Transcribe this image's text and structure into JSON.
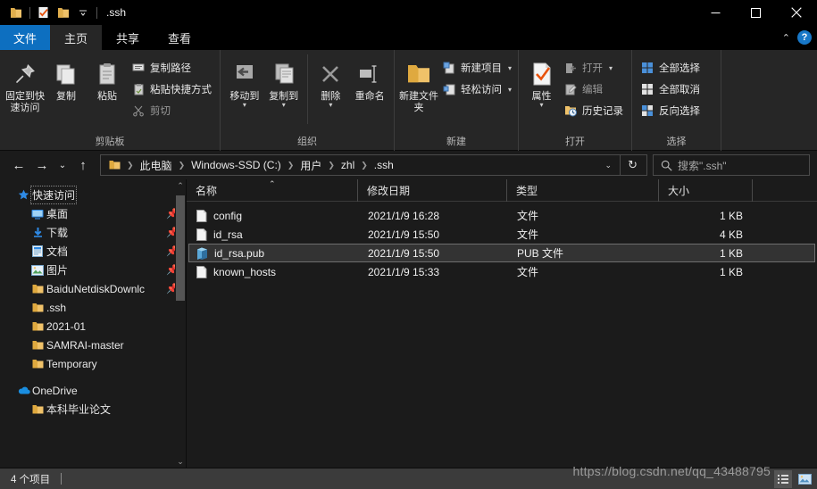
{
  "window": {
    "title": ".ssh",
    "quick_access": [
      {
        "name": "folder-icon",
        "label": "文件资源管理器"
      },
      {
        "name": "properties-icon",
        "label": "属性"
      },
      {
        "name": "new-folder-icon",
        "label": "新建文件夹"
      },
      {
        "name": "customize-chevron-icon",
        "label": "自定义快速访问工具栏"
      }
    ],
    "controls": {
      "minimize": "–",
      "maximize": "☐",
      "close": "✕"
    }
  },
  "tabs": [
    {
      "label": "文件",
      "kind": "file"
    },
    {
      "label": "主页",
      "kind": "active"
    },
    {
      "label": "共享",
      "kind": "normal"
    },
    {
      "label": "查看",
      "kind": "normal"
    }
  ],
  "tabbar_right": {
    "collapse": "⌃",
    "help": "?"
  },
  "ribbon": {
    "groups": [
      {
        "label": "剪贴板",
        "big": [
          {
            "label": "固定到快速访问",
            "icon": "pin-icon"
          },
          {
            "label": "复制",
            "icon": "copy-icon"
          },
          {
            "label": "粘贴",
            "icon": "paste-icon"
          }
        ],
        "small": [
          {
            "label": "复制路径",
            "icon": "copy-path-icon",
            "dim": false
          },
          {
            "label": "粘贴快捷方式",
            "icon": "paste-shortcut-icon",
            "dim": false
          },
          {
            "label": "剪切",
            "icon": "scissors-icon",
            "dim": true
          }
        ]
      },
      {
        "label": "组织",
        "big": [
          {
            "label": "移动到",
            "icon": "move-to-icon",
            "caret": true
          },
          {
            "label": "复制到",
            "icon": "copy-to-icon",
            "caret": true
          },
          {
            "label": "删除",
            "icon": "delete-icon",
            "caret": true
          },
          {
            "label": "重命名",
            "icon": "rename-icon",
            "caret": false
          }
        ]
      },
      {
        "label": "新建",
        "big": [
          {
            "label": "新建文件夹",
            "icon": "new-folder-icon"
          }
        ],
        "small": [
          {
            "label": "新建项目",
            "icon": "new-item-icon",
            "caret": true
          },
          {
            "label": "轻松访问",
            "icon": "easy-access-icon",
            "caret": true
          }
        ]
      },
      {
        "label": "打开",
        "big": [
          {
            "label": "属性",
            "icon": "properties-icon",
            "caret": true
          }
        ],
        "small": [
          {
            "label": "打开",
            "icon": "open-icon",
            "caret": true,
            "dim": true
          },
          {
            "label": "编辑",
            "icon": "edit-icon",
            "dim": true
          },
          {
            "label": "历史记录",
            "icon": "history-icon",
            "dim": false
          }
        ]
      },
      {
        "label": "选择",
        "small": [
          {
            "label": "全部选择",
            "icon": "select-all-icon"
          },
          {
            "label": "全部取消",
            "icon": "select-none-icon"
          },
          {
            "label": "反向选择",
            "icon": "invert-selection-icon"
          }
        ]
      }
    ]
  },
  "addressbar": {
    "back": "←",
    "forward": "→",
    "recent": "⌄",
    "up": "↑",
    "breadcrumbs": [
      "此电脑",
      "Windows-SSD (C:)",
      "用户",
      "zhl",
      ".ssh"
    ],
    "dropdown": "⌄",
    "refresh": "↻",
    "search_placeholder": "搜索\".ssh\"",
    "search_value": ""
  },
  "sidebar": {
    "items": [
      {
        "label": "快速访问",
        "icon": "star-icon",
        "level": "root",
        "pinned": false,
        "focus": true
      },
      {
        "label": "桌面",
        "icon": "desktop-icon",
        "level": "child",
        "pinned": true
      },
      {
        "label": "下载",
        "icon": "downloads-icon",
        "level": "child",
        "pinned": true
      },
      {
        "label": "文档",
        "icon": "documents-icon",
        "level": "child",
        "pinned": true
      },
      {
        "label": "图片",
        "icon": "pictures-icon",
        "level": "child",
        "pinned": true
      },
      {
        "label": "BaiduNetdiskDownlc",
        "icon": "folder-icon",
        "level": "child",
        "pinned": true
      },
      {
        "label": ".ssh",
        "icon": "folder-icon",
        "level": "child",
        "pinned": false
      },
      {
        "label": "2021-01",
        "icon": "folder-icon",
        "level": "child",
        "pinned": false
      },
      {
        "label": "SAMRAI-master",
        "icon": "folder-icon",
        "level": "child",
        "pinned": false
      },
      {
        "label": "Temporary",
        "icon": "folder-icon",
        "level": "child",
        "pinned": false
      },
      {
        "label": "OneDrive",
        "icon": "onedrive-icon",
        "level": "root",
        "pinned": false
      },
      {
        "label": "本科毕业论文",
        "icon": "folder-icon",
        "level": "child",
        "pinned": false
      }
    ],
    "scroll_up": "⌃",
    "scroll_down": "⌄"
  },
  "filelist": {
    "columns": [
      {
        "key": "name",
        "label": "名称",
        "sorted": true,
        "sort_dir": "asc"
      },
      {
        "key": "date",
        "label": "修改日期"
      },
      {
        "key": "type",
        "label": "类型"
      },
      {
        "key": "size",
        "label": "大小"
      }
    ],
    "rows": [
      {
        "name": "config",
        "date": "2021/1/9 16:28",
        "type": "文件",
        "size": "1 KB",
        "icon": "file-icon",
        "selected": false
      },
      {
        "name": "id_rsa",
        "date": "2021/1/9 15:50",
        "type": "文件",
        "size": "4 KB",
        "icon": "file-icon",
        "selected": false
      },
      {
        "name": "id_rsa.pub",
        "date": "2021/1/9 15:50",
        "type": "PUB 文件",
        "size": "1 KB",
        "icon": "pub-file-icon",
        "selected": true
      },
      {
        "name": "known_hosts",
        "date": "2021/1/9 15:33",
        "type": "文件",
        "size": "1 KB",
        "icon": "file-icon",
        "selected": false
      }
    ]
  },
  "statusbar": {
    "item_count": "4 个项目",
    "view_details_icon": "details-view-icon",
    "view_large_icon": "large-icons-view-icon"
  },
  "watermark": "https://blog.csdn.net/qq_43488795",
  "colors": {
    "accent": "#0d6fc0",
    "window_bg": "#1b1b1b",
    "ribbon_bg": "#262626",
    "titlebar_bg": "#000000",
    "statusbar_bg": "#3b3b3b",
    "selection_bg": "#333333",
    "folder_yellow": "#f5c76a",
    "text": "#e8e8e8"
  }
}
